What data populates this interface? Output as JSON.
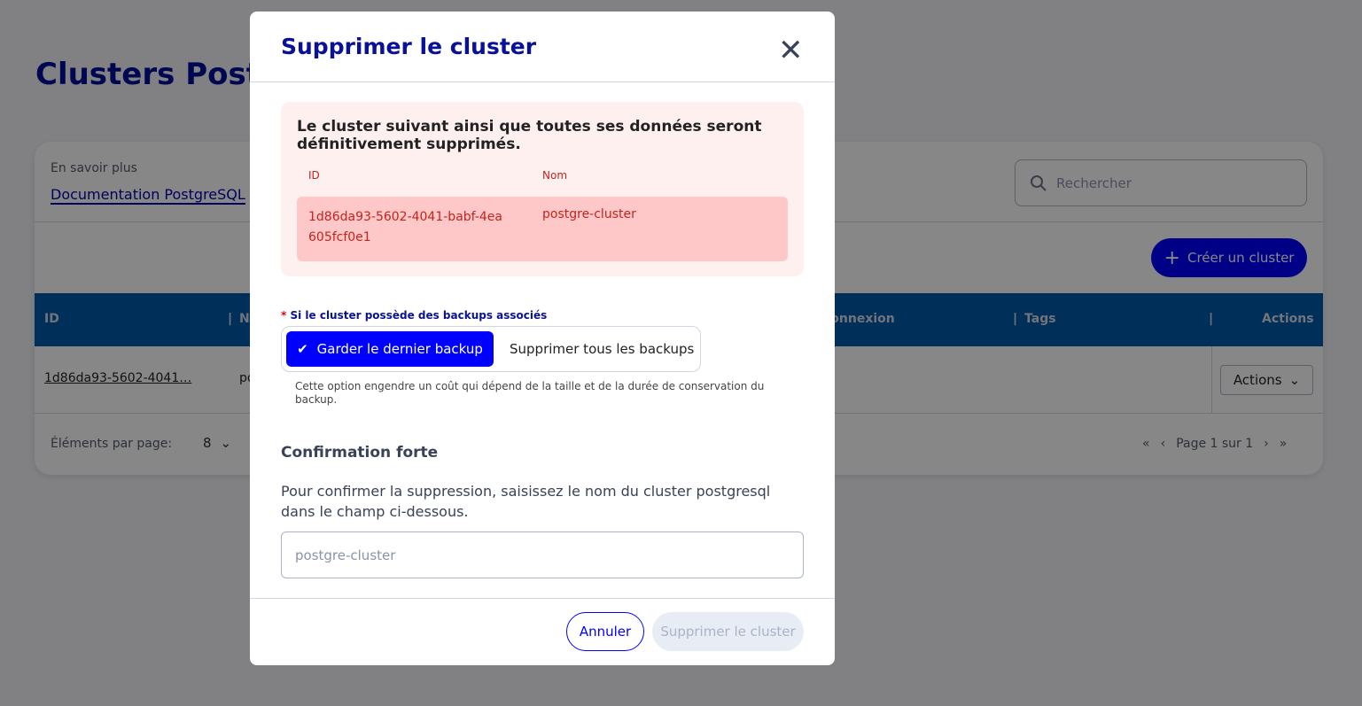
{
  "page": {
    "title": "Clusters PostgreSQL",
    "learn_more": "En savoir plus",
    "doc_link": "Documentation PostgreSQL",
    "search_placeholder": "Rechercher",
    "create_button": "Créer un cluster",
    "columns": [
      "ID",
      "Nom",
      "Connexion",
      "Tags",
      "Actions"
    ],
    "rows": [
      {
        "id": "1d86da93-5602-4041…",
        "name": "postgre-cluster",
        "actions": "Actions"
      }
    ],
    "per_page_label": "Éléments par page:",
    "per_page_value": "8",
    "pagination": "Page 1 sur 1"
  },
  "modal": {
    "title": "Supprimer le cluster",
    "warning": "Le cluster suivant ainsi que toutes ses données seront définitivement supprimés.",
    "id_label": "ID",
    "name_label": "Nom",
    "cluster_id": "1d86da93-5602-4041-babf-4ea605fcf0e1",
    "cluster_name": "postgre-cluster",
    "backup_label": "Si le cluster possède des backups associés",
    "required_mark": "*",
    "backup_options": [
      "Garder le dernier backup",
      "Supprimer tous les backups"
    ],
    "backup_selected": "Garder le dernier backup",
    "backup_help": "Cette option engendre un coût qui dépend de la taille et de la durée de conservation du backup.",
    "confirm_title": "Confirmation forte",
    "confirm_text": "Pour confirmer la suppression, saisissez le nom du cluster postgresql dans le champ ci-dessous.",
    "confirm_placeholder": "postgre-cluster",
    "confirm_value": "",
    "cancel": "Annuler",
    "delete": "Supprimer le cluster"
  },
  "colors": {
    "primary": "#0000ff",
    "danger": "#c4231d",
    "table_header": "#005aab"
  }
}
